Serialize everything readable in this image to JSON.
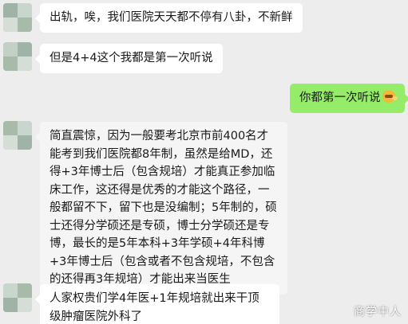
{
  "messages": [
    {
      "side": "left",
      "text": "出轨，唉，我们医院天天都不停有八卦，不新鲜"
    },
    {
      "side": "left",
      "text": "但是4+4这个我都是第一次听说"
    },
    {
      "side": "right",
      "text": "你都第一次听说",
      "emoji": "grimace-emoji"
    },
    {
      "side": "left",
      "text": "简直震惊，因为一般要考北京市前400名才能考到我们医院都8年制，虽然是给MD，还得+3年博士后（包含规培）才能真正参加临床工作，这还得是优秀的才能这个路径，一般都留不下，留下也是没编制；5年制的，硕士还得分学硕还是专硕，博士分学硕还是专博，最长的是5年本科+3年学硕+4年科博+3年博士后（包含或者不包含规培，不包含的还得再3年规培）才能出来当医生"
    },
    {
      "side": "left",
      "text": "人家权贵们学4年医+1年规培就出来干顶级肿瘤医院外科了"
    }
  ],
  "watermark": "商学中人",
  "colors": {
    "background": "#ededed",
    "bubble_left": "#ffffff",
    "bubble_right": "#95ec69"
  }
}
